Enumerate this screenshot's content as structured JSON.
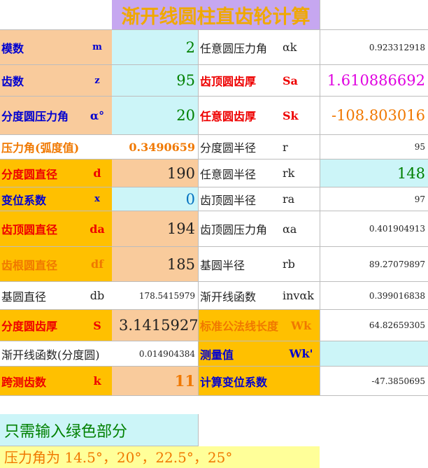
{
  "title": "渐开线圆柱直齿轮计算",
  "rows": [
    {
      "l_label": "模数",
      "l_sym": "m",
      "l_val": "2",
      "r_label": "任意圆压力角",
      "r_sym": "αk",
      "r_val": "0.923312918"
    },
    {
      "l_label": "齿数",
      "l_sym": "z",
      "l_val": "95",
      "r_label": "齿顶圆齿厚",
      "r_sym": "Sa",
      "r_val": "1.610886692"
    },
    {
      "l_label": "分度圆压力角",
      "l_sym": "α°",
      "l_val": "20",
      "r_label": "任意圆齿厚",
      "r_sym": "Sk",
      "r_val": "-108.803016"
    },
    {
      "l_label": "压力角(弧度值)",
      "l_sym": "",
      "l_val": "0.3490659",
      "r_label": "分度圆半径",
      "r_sym": "r",
      "r_val": "95"
    },
    {
      "l_label": "分度圆直径",
      "l_sym": "d",
      "l_val": "190",
      "r_label": "任意圆半径",
      "r_sym": "rk",
      "r_val": "148"
    },
    {
      "l_label": "变位系数",
      "l_sym": "x",
      "l_val": "0",
      "r_label": "齿顶圆半径",
      "r_sym": "ra",
      "r_val": "97"
    },
    {
      "l_label": "齿顶圆直径",
      "l_sym": "da",
      "l_val": "194",
      "r_label": "齿顶圆压力角",
      "r_sym": "αa",
      "r_val": "0.401904913"
    },
    {
      "l_label": "齿根圆直径",
      "l_sym": "df",
      "l_val": "185",
      "r_label": "基圆半径",
      "r_sym": "rb",
      "r_val": "89.27079897"
    },
    {
      "l_label": "基圆直径",
      "l_sym": "db",
      "l_val": "178.5415979",
      "r_label": "渐开线函数",
      "r_sym": "invαk",
      "r_val": "0.399016838"
    },
    {
      "l_label": "分度圆齿厚",
      "l_sym": "S",
      "l_val": "3.1415927",
      "r_label": "标准公法线长度",
      "r_sym": "Wk",
      "r_val": "64.82659305"
    },
    {
      "l_label": "渐开线函数(分度圆)",
      "l_sym": "",
      "l_val": "0.014904384",
      "r_label": "测量值",
      "r_sym": "Wk'",
      "r_val": ""
    },
    {
      "l_label": "跨测齿数",
      "l_sym": "k",
      "l_val": "11",
      "r_label": "计算变位系数",
      "r_sym": "",
      "r_val": "-47.3850695"
    }
  ],
  "note": "只需输入绿色部分",
  "note2": "压力角为 14.5°，20°，22.5°，25°"
}
